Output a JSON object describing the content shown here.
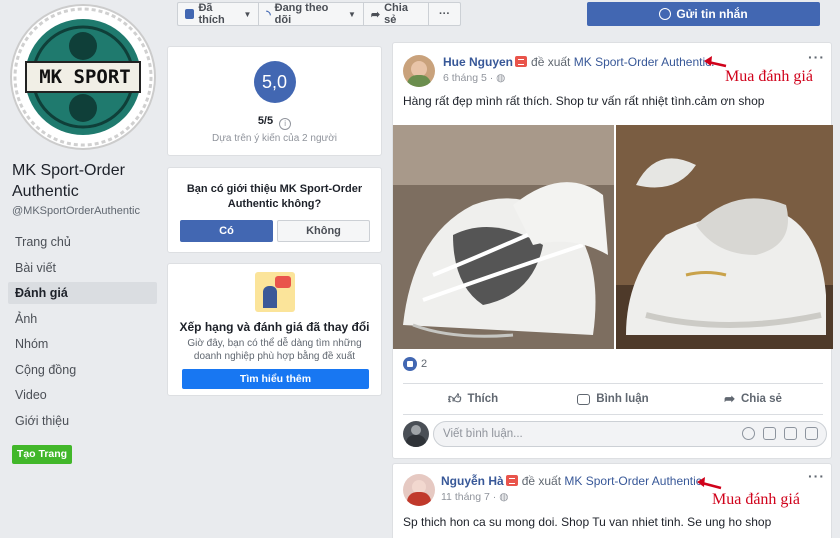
{
  "page": {
    "logo_text": "MK SPORT",
    "name": "MK Sport-Order Authentic",
    "handle": "@MKSportOrderAuthentic"
  },
  "nav": {
    "items": [
      "Trang chủ",
      "Bài viết",
      "Đánh giá",
      "Ảnh",
      "Nhóm",
      "Cộng đồng",
      "Video",
      "Giới thiệu"
    ],
    "active": "Đánh giá",
    "create_page": "Tạo Trang"
  },
  "toolbar": {
    "liked": "Đã thích",
    "following": "Đang theo dõi",
    "share": "Chia sẻ",
    "more": "···",
    "send_message": "Gửi tin nhắn"
  },
  "rating": {
    "score": "5,0",
    "out_of": "5/5",
    "based_on": "Dựa trên ý kiến của 2 người"
  },
  "recommend": {
    "question": "Bạn có giới thiệu MK Sport-Order Authentic không?",
    "yes": "Có",
    "no": "Không"
  },
  "change_notice": {
    "title": "Xếp hạng và đánh giá đã thay đổi",
    "description": "Giờ đây, bạn có thể dễ dàng tìm những doanh nghiệp phù hợp bằng đề xuất",
    "learn_more": "Tìm hiểu thêm"
  },
  "posts": [
    {
      "author": "Hue Nguyen",
      "verb": "đề xuất",
      "target": "MK Sport-Order Authentic.",
      "date": "6 tháng 5",
      "text": "Hàng rất đẹp mình rất thích. Shop tư vấn rất nhiệt tình.cảm ơn shop",
      "like_count": "2",
      "annotation": "Mua đánh giá"
    },
    {
      "author": "Nguyễn Hà",
      "verb": "đề xuất",
      "target": "MK Sport-Order Authentic.",
      "date": "11 tháng 7",
      "text": "Sp thich hon ca su mong doi. Shop Tu van nhiet tinh. Se ung ho shop",
      "annotation": "Mua đánh giá"
    }
  ],
  "actions": {
    "like": "Thích",
    "comment": "Bình luận",
    "share": "Chia sẻ"
  },
  "comment_placeholder": "Viết bình luận...",
  "colors": {
    "facebook_blue": "#4267b2",
    "link_blue": "#385898",
    "annotation_red": "#d0021b",
    "create_green": "#42b72a"
  }
}
